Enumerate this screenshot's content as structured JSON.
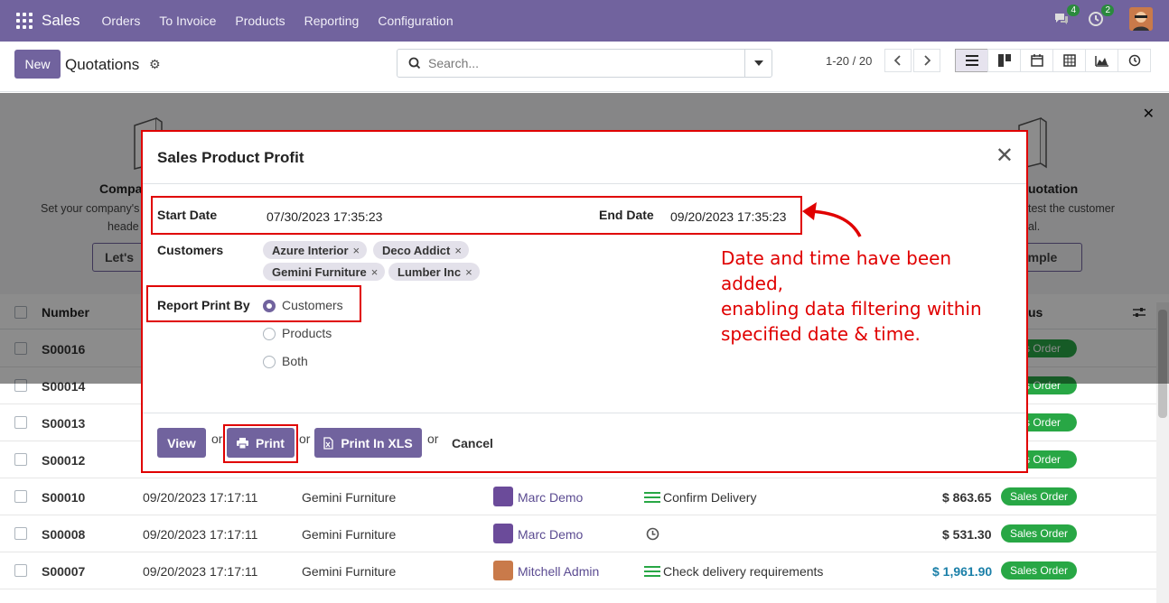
{
  "navbar": {
    "app_name": "Sales",
    "menu": [
      "Orders",
      "To Invoice",
      "Products",
      "Reporting",
      "Configuration"
    ],
    "chat_count": "4",
    "activity_count": "2"
  },
  "control_panel": {
    "new_label": "New",
    "title": "Quotations",
    "search_placeholder": "Search...",
    "pager": "1-20 / 20"
  },
  "helper": {
    "card1_title": "Compa",
    "card1_text1": "Set your company's",
    "card1_text2": "heade",
    "card1_button": "Let's",
    "card4_title": "uotation",
    "card4_text1": "test the customer",
    "card4_text2": "al.",
    "card4_button": "mple"
  },
  "list": {
    "headers": {
      "number": "Number",
      "status": "us"
    },
    "rows": [
      {
        "number": "S00016",
        "status": "les Order"
      },
      {
        "number": "S00014",
        "status": "les Order"
      },
      {
        "number": "S00013",
        "status": "les Order"
      },
      {
        "number": "S00012",
        "status": "les Order"
      },
      {
        "number": "S00010",
        "date": "09/20/2023 17:17:11",
        "customer": "Gemini Furniture",
        "salesperson": "Marc Demo",
        "activity": "Confirm Delivery",
        "total": "$ 863.65",
        "status": "Sales Order"
      },
      {
        "number": "S00008",
        "date": "09/20/2023 17:17:11",
        "customer": "Gemini Furniture",
        "salesperson": "Marc Demo",
        "activity": "",
        "total": "$ 531.30",
        "status": "Sales Order"
      },
      {
        "number": "S00007",
        "date": "09/20/2023 17:17:11",
        "customer": "Gemini Furniture",
        "salesperson": "Mitchell Admin",
        "activity": "Check delivery requirements",
        "total": "$ 1,961.90",
        "status": "Sales Order"
      }
    ]
  },
  "dialog": {
    "title": "Sales Product Profit",
    "start_date_label": "Start Date",
    "start_date_value": "07/30/2023 17:35:23",
    "end_date_label": "End Date",
    "end_date_value": "09/20/2023 17:35:23",
    "customers_label": "Customers",
    "customers": [
      "Azure Interior",
      "Deco Addict",
      "Gemini Furniture",
      "Lumber Inc"
    ],
    "report_print_by_label": "Report Print By",
    "options": [
      "Customers",
      "Products",
      "Both"
    ],
    "selected_option": "Customers",
    "buttons": {
      "view": "View",
      "print": "Print",
      "print_xls": "Print In XLS",
      "or": "or",
      "cancel": "Cancel"
    }
  },
  "annotation": {
    "line1": "Date and time have been added,",
    "line2": "enabling data filtering within",
    "line3": "specified date & time."
  },
  "colors": {
    "brand": "#71639e",
    "highlight": "#e00000",
    "status_green": "#28a745"
  }
}
